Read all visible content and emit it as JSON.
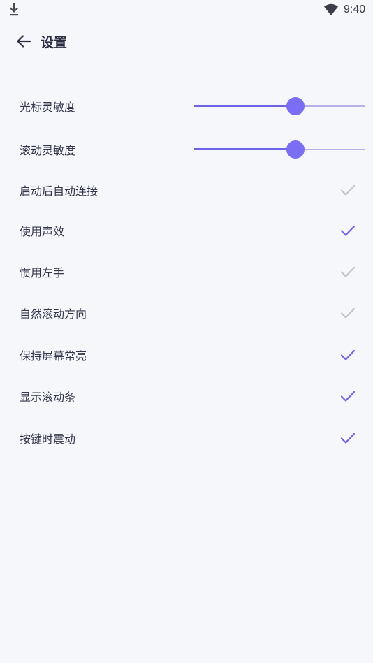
{
  "status_bar": {
    "time": "9:40",
    "left_icon": "download-icon",
    "right_icon": "wifi-icon"
  },
  "header": {
    "title": "设置",
    "back_icon": "arrow-left-icon"
  },
  "sliders": [
    {
      "label": "光标灵敏度",
      "value": 0.59
    },
    {
      "label": "滚动灵敏度",
      "value": 0.59
    }
  ],
  "toggles": [
    {
      "label": "启动后自动连接",
      "checked": false
    },
    {
      "label": "使用声效",
      "checked": true
    },
    {
      "label": "惯用左手",
      "checked": false
    },
    {
      "label": "自然滚动方向",
      "checked": false
    },
    {
      "label": "保持屏幕常亮",
      "checked": true
    },
    {
      "label": "显示滚动条",
      "checked": true
    },
    {
      "label": "按键时震动",
      "checked": true
    }
  ],
  "colors": {
    "background": "#f6f7fb",
    "accent": "#7a6ef5",
    "accent_dark": "#6e63e8",
    "track_inactive": "#b6b2e6",
    "check_on": "#6e63e8",
    "check_off": "#c4c4c8",
    "text": "#33364a"
  }
}
